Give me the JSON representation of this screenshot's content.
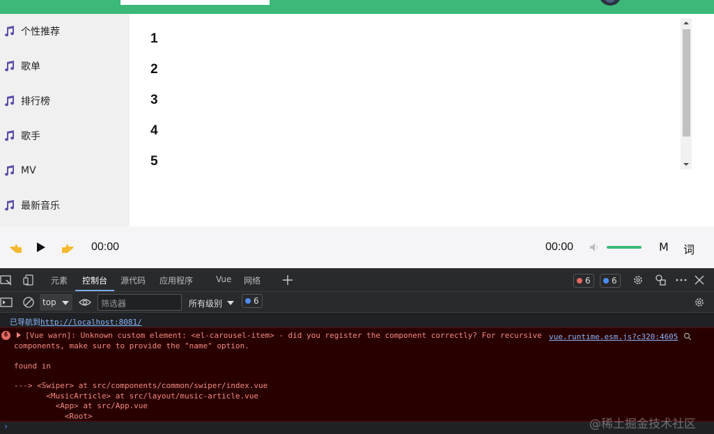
{
  "sidebar": {
    "items": [
      {
        "label": "个性推荐"
      },
      {
        "label": "歌单"
      },
      {
        "label": "排行榜"
      },
      {
        "label": "歌手"
      },
      {
        "label": "MV"
      },
      {
        "label": "最新音乐"
      }
    ]
  },
  "main": {
    "carousel_items": [
      "1",
      "2",
      "3",
      "4",
      "5"
    ]
  },
  "player": {
    "current_time": "00:00",
    "total_time": "00:00",
    "volume_level": 1.0,
    "mode_label": "M",
    "lyrics_label": "词"
  },
  "devtools": {
    "tabs": {
      "elements": "元素",
      "console": "控制台",
      "sources": "源代码",
      "application": "应用程序",
      "vue": "Vue",
      "network": "网络"
    },
    "error_count": "6",
    "message_count": "6",
    "context": "top",
    "filter_placeholder": "筛选器",
    "levels": "所有级别",
    "issues_count": "6",
    "console": {
      "nav_label": "已导航到",
      "nav_url": "http://localhost:8081/",
      "error_badge": "6",
      "lines": [
        "[Vue warn]: Unknown custom element: <el-carousel-item> - did you register the component correctly? For recursive",
        "components, make sure to provide the \"name\" option.",
        "",
        "found in",
        "",
        "---> <Swiper> at src/components/common/swiper/index.vue",
        "       <MusicArticle> at src/layout/music-article.vue",
        "         <App> at src/App.vue",
        "           <Root>"
      ],
      "source": "vue.runtime.esm.js?c320:4605"
    }
  },
  "colors": {
    "brand": "#3cb878",
    "sidebar_icon": "#5b4fa8",
    "error_bg": "#290000",
    "error_text": "#f28b82",
    "link": "#8ab4f8"
  },
  "watermark": "@稀土掘金技术社区"
}
